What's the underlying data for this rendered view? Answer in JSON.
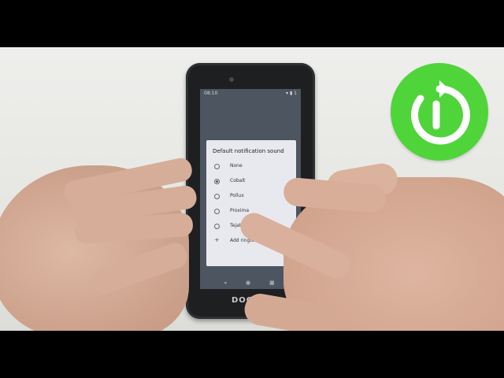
{
  "phone": {
    "brand": "DOOGEE",
    "status": {
      "time": "08:10",
      "battery": "▾ ▮ 1"
    },
    "dialog": {
      "title": "Default notification sound",
      "options": [
        {
          "label": "None",
          "checked": false
        },
        {
          "label": "Cobalt",
          "checked": true
        },
        {
          "label": "Pollux",
          "checked": false
        },
        {
          "label": "Proxima",
          "checked": false
        },
        {
          "label": "Tejat",
          "checked": false
        }
      ],
      "add_label": "Add ringtone"
    },
    "nav": {
      "back": "◂",
      "home": "●",
      "recent": "■"
    }
  },
  "colors": {
    "logo_green": "#4fd43a",
    "dialog_bg": "#e8e9ef",
    "screen_bg": "#4c5560"
  }
}
